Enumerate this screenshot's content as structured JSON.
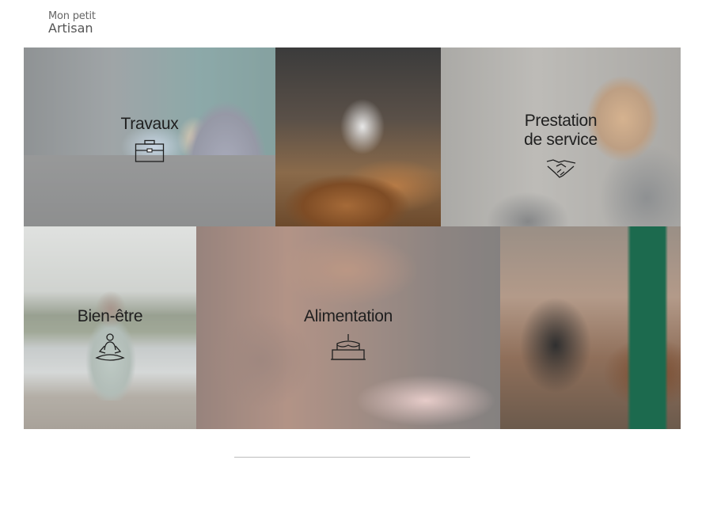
{
  "brand": {
    "line1": "Mon petit",
    "line2": "Artisan"
  },
  "tiles": [
    {
      "label": "Travaux",
      "icon": "toolbox-icon"
    },
    {
      "label": "",
      "icon": ""
    },
    {
      "label_line1": "Prestation",
      "label_line2": "de service",
      "icon": "handshake-icon"
    },
    {
      "label": "Bien-être",
      "icon": "meditation-icon"
    },
    {
      "label": "Alimentation",
      "icon": "cake-icon"
    },
    {
      "label": "",
      "icon": ""
    }
  ]
}
